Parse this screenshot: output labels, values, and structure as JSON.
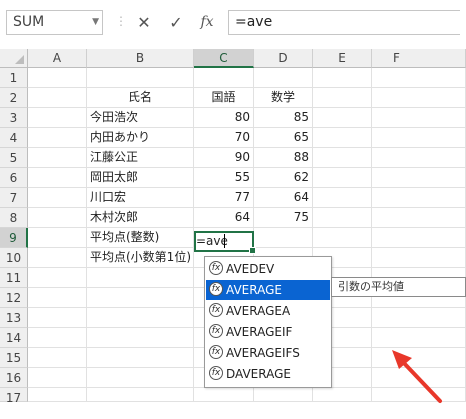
{
  "formula_bar": {
    "name_box": "SUM",
    "formula": "=ave"
  },
  "columns": [
    "A",
    "B",
    "C",
    "D",
    "E",
    "F"
  ],
  "rows": [
    "1",
    "2",
    "3",
    "4",
    "5",
    "6",
    "7",
    "8",
    "9",
    "10",
    "11",
    "12",
    "13",
    "14",
    "15",
    "16",
    "17"
  ],
  "table": {
    "header": {
      "name": "氏名",
      "kokugo": "国語",
      "sugaku": "数学"
    },
    "students": [
      {
        "name": "今田浩次",
        "kokugo": "80",
        "sugaku": "85"
      },
      {
        "name": "内田あかり",
        "kokugo": "70",
        "sugaku": "65"
      },
      {
        "name": "江藤公正",
        "kokugo": "90",
        "sugaku": "88"
      },
      {
        "name": "岡田太郎",
        "kokugo": "55",
        "sugaku": "62"
      },
      {
        "name": "川口宏",
        "kokugo": "77",
        "sugaku": "64"
      },
      {
        "name": "木村次郎",
        "kokugo": "64",
        "sugaku": "75"
      }
    ],
    "avg_int_label": "平均点(整数)",
    "avg_dec_label": "平均点(小数第1位)"
  },
  "editing_cell": {
    "ref": "C9",
    "text": "=ave"
  },
  "autocomplete": {
    "items": [
      "AVEDEV",
      "AVERAGE",
      "AVERAGEA",
      "AVERAGEIF",
      "AVERAGEIFS",
      "DAVERAGE"
    ],
    "selected": "AVERAGE",
    "tooltip": "引数の平均値"
  },
  "colors": {
    "accent": "#217346",
    "selection": "#0a64d2",
    "arrow": "#e8372a"
  }
}
